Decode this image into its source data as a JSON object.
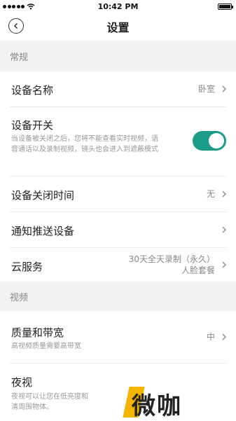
{
  "status_bar": {
    "time": "10:42 PM"
  },
  "nav": {
    "title": "设置"
  },
  "sections": {
    "general": "常规",
    "video": "视频"
  },
  "rows": {
    "device_name": {
      "label": "设备名称",
      "value": "卧室"
    },
    "device_switch": {
      "label": "设备开关",
      "desc_line1": "当设备被关闭之后，您将不能查看实时视频，语",
      "desc_line2": "音通话以及录制视频，镜头也会进入到遮蔽模式",
      "enabled": true
    },
    "off_time": {
      "label": "设备关闭时间",
      "value": "无"
    },
    "notify_devices": {
      "label": "通知推送设备"
    },
    "cloud": {
      "label": "云服务",
      "value_line1": "30天全天录制（永久）",
      "value_line2": "人脸套餐"
    },
    "quality": {
      "label": "质量和带宽",
      "desc": "高视频质量需要高带宽",
      "value": "中"
    },
    "night_vision": {
      "label": "夜视",
      "desc_line1": "夜视可以让您在低亮度和",
      "desc_line2": "清周围物体。"
    }
  },
  "watermark": {
    "text": "微咖"
  },
  "colors": {
    "accent": "#1a9c88",
    "section_bg": "#f2f2f2",
    "watermark_bar": "#f4b400"
  },
  "icons": [
    "signal-icon",
    "wifi-icon",
    "battery-icon",
    "back-icon",
    "chevron-right-icon"
  ]
}
